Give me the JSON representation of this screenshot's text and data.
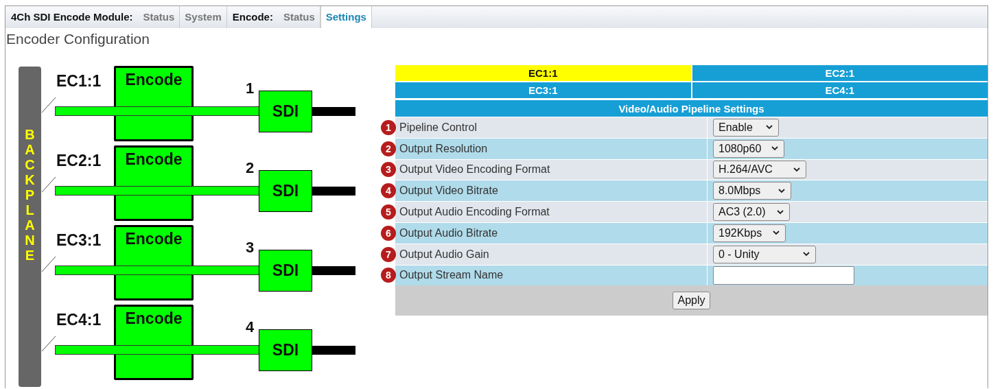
{
  "nav": [
    {
      "kind": "group",
      "label": "4Ch SDI Encode Module:"
    },
    {
      "kind": "tab",
      "label": "Status",
      "selected": false
    },
    {
      "kind": "tab",
      "label": "System",
      "selected": false
    },
    {
      "kind": "group",
      "label": "Encode:"
    },
    {
      "kind": "tab",
      "label": "Status",
      "selected": false
    },
    {
      "kind": "tab",
      "label": "Settings",
      "selected": true
    }
  ],
  "heading": "Encoder Configuration",
  "diagram": {
    "backplane": "BACKPLANE",
    "channels": [
      {
        "label": "EC1:1",
        "block": "Encode",
        "port_number": "1",
        "port": "SDI"
      },
      {
        "label": "EC2:1",
        "block": "Encode",
        "port_number": "2",
        "port": "SDI"
      },
      {
        "label": "EC3:1",
        "block": "Encode",
        "port_number": "3",
        "port": "SDI"
      },
      {
        "label": "EC4:1",
        "block": "Encode",
        "port_number": "4",
        "port": "SDI"
      }
    ]
  },
  "channel_tabs": [
    {
      "label": "EC1:1",
      "selected": true
    },
    {
      "label": "EC2:1",
      "selected": false
    },
    {
      "label": "EC3:1",
      "selected": false
    },
    {
      "label": "EC4:1",
      "selected": false
    }
  ],
  "settings": {
    "title": "Video/Audio Pipeline Settings",
    "rows": [
      {
        "badge": "1",
        "label": "Pipeline Control",
        "kind": "select",
        "value": "Enable"
      },
      {
        "badge": "2",
        "label": "Output Resolution",
        "kind": "select",
        "value": "1080p60"
      },
      {
        "badge": "3",
        "label": "Output Video Encoding Format",
        "kind": "select",
        "value": "H.264/AVC"
      },
      {
        "badge": "4",
        "label": "Output Video Bitrate",
        "kind": "select",
        "value": "8.0Mbps"
      },
      {
        "badge": "5",
        "label": "Output Audio Encoding Format",
        "kind": "select",
        "value": "AC3 (2.0)"
      },
      {
        "badge": "6",
        "label": "Output Audio Bitrate",
        "kind": "select",
        "value": "192Kbps"
      },
      {
        "badge": "7",
        "label": "Output Audio Gain",
        "kind": "select",
        "value": "0 - Unity"
      },
      {
        "badge": "8",
        "label": "Output Stream Name",
        "kind": "text"
      }
    ],
    "button": "Apply"
  }
}
